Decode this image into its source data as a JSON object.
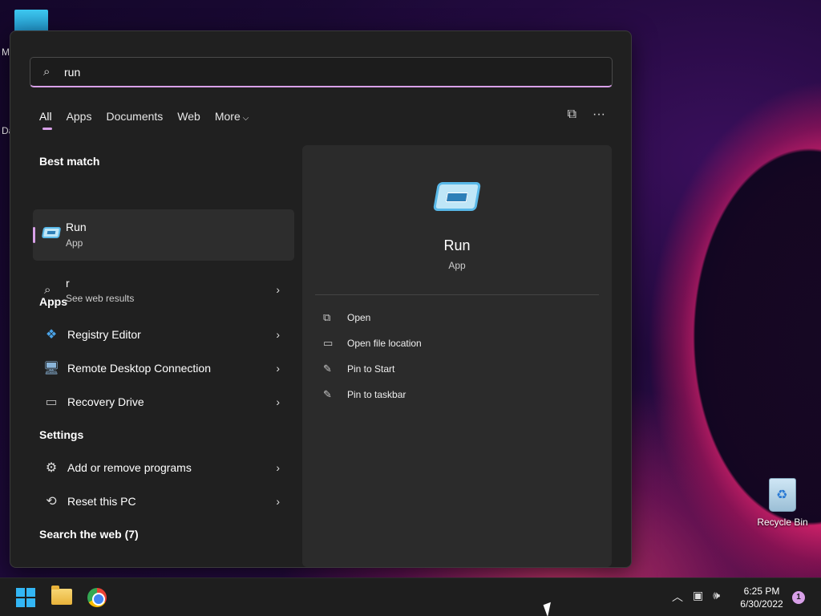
{
  "desktop": {
    "fragments": [
      "M",
      "Da"
    ],
    "recycle_bin": {
      "label": "Recycle Bin",
      "icon": "recycle-bin-icon"
    }
  },
  "search": {
    "query": "run",
    "icon": "search-icon"
  },
  "tabs": [
    {
      "label": "All",
      "active": true
    },
    {
      "label": "Apps"
    },
    {
      "label": "Documents"
    },
    {
      "label": "Web"
    },
    {
      "label": "More"
    }
  ],
  "toolbar": {
    "share_icon": "share-icon",
    "more_icon": "ellipsis-icon"
  },
  "left": {
    "best_match_title": "Best match",
    "best_match": {
      "name": "Run",
      "type": "App",
      "icon": "run-icon"
    },
    "web_result": {
      "query": "r",
      "sub": "See web results",
      "icon": "search-icon"
    },
    "apps_title": "Apps",
    "apps": [
      {
        "label": "Registry Editor",
        "icon": "registry-editor-icon"
      },
      {
        "label": "Remote Desktop Connection",
        "icon": "remote-desktop-icon"
      },
      {
        "label": "Recovery Drive",
        "icon": "drive-icon"
      }
    ],
    "settings_title": "Settings",
    "settings": [
      {
        "label": "Add or remove programs",
        "icon": "gear-icon"
      },
      {
        "label": "Reset this PC",
        "icon": "reset-icon"
      }
    ],
    "search_web_title": "Search the web (7)"
  },
  "detail": {
    "name": "Run",
    "type": "App",
    "actions": [
      {
        "label": "Open",
        "icon": "open-icon"
      },
      {
        "label": "Open file location",
        "icon": "folder-icon"
      },
      {
        "label": "Pin to Start",
        "icon": "pin-icon"
      },
      {
        "label": "Pin to taskbar",
        "icon": "pin-icon"
      }
    ]
  },
  "taskbar": {
    "time": "6:25 PM",
    "date": "6/30/2022",
    "notifications": "1",
    "apps": [
      "start-button",
      "file-explorer",
      "chrome"
    ]
  },
  "colors": {
    "accent": "#d8a0e8",
    "panel": "#202020",
    "detail": "#2b2b2b"
  }
}
